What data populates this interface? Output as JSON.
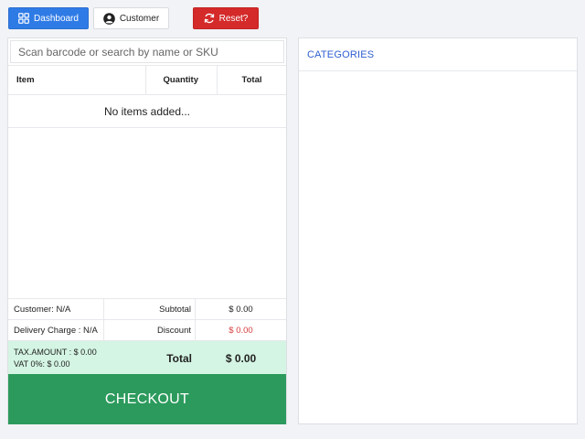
{
  "toolbar": {
    "dashboard_label": "Dashboard",
    "customer_label": "Customer",
    "reset_label": "Reset?"
  },
  "cart": {
    "search_placeholder": "Scan barcode or search by name or SKU",
    "columns": {
      "item": "Item",
      "quantity": "Quantity",
      "total": "Total"
    },
    "empty_message": "No items added..."
  },
  "summary": {
    "customer": "Customer: N/A",
    "subtotal_label": "Subtotal",
    "subtotal_value": "$ 0.00",
    "delivery_charge": "Delivery Charge : N/A",
    "discount_label": "Discount",
    "discount_value": "$ 0.00",
    "tax_amount": "TAX.AMOUNT : $ 0.00",
    "vat": "VAT 0%: $ 0.00",
    "total_label": "Total",
    "total_value": "$ 0.00"
  },
  "checkout_label": "CHECKOUT",
  "categories": {
    "title": "CATEGORIES"
  },
  "colors": {
    "primary": "#2f7be6",
    "danger": "#d42a2a",
    "success": "#2b9a5c",
    "summary_highlight": "#d4f5e3",
    "category_title": "#2f5fd0"
  },
  "icons": {
    "dashboard": "grid-icon",
    "customer": "user-circle-icon",
    "reset": "refresh-icon"
  }
}
